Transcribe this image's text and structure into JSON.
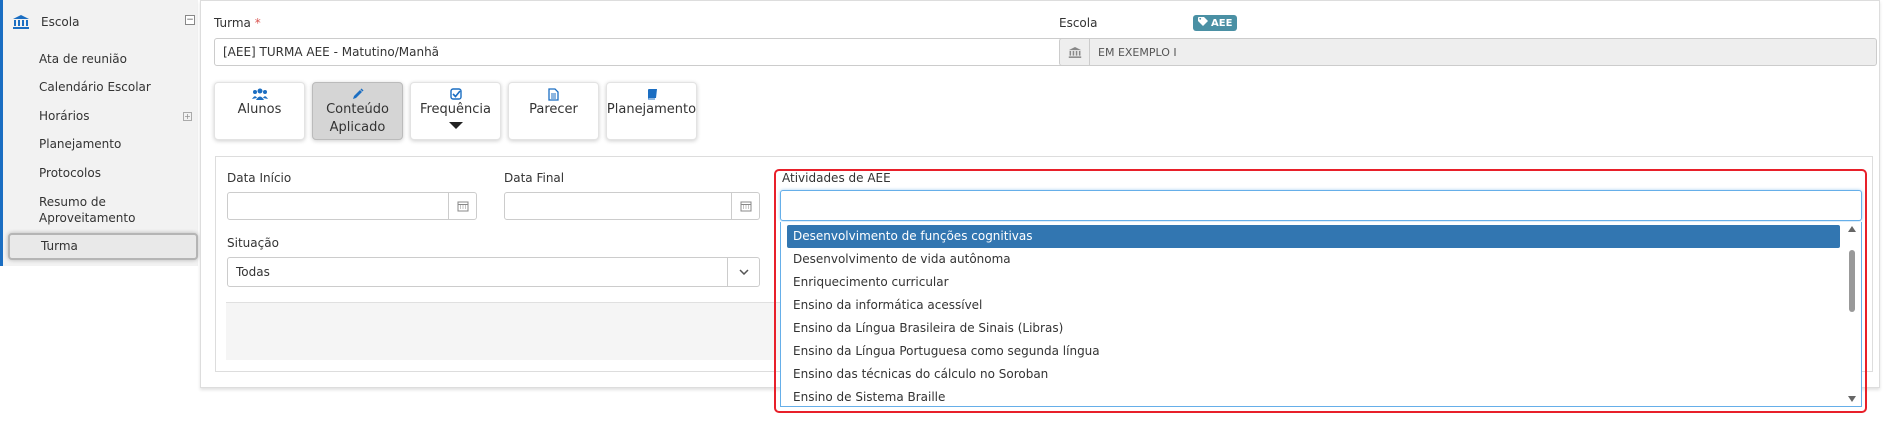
{
  "sidebar": {
    "header_label": "Escola",
    "items": [
      {
        "label": "Ata de reunião"
      },
      {
        "label": "Calendário Escolar"
      },
      {
        "label": "Horários"
      },
      {
        "label": "Planejamento"
      },
      {
        "label": "Protocolos"
      },
      {
        "label": "Resumo de"
      },
      {
        "label": "Aproveitamento"
      },
      {
        "label": "Turma"
      }
    ]
  },
  "form": {
    "turma_label": "Turma",
    "required_mark": "*",
    "aee_badge": "AEE",
    "turma_value": "[AEE]  TURMA AEE - Matutino/Manhã",
    "escola_label": "Escola",
    "escola_value": "EM EXEMPLO I"
  },
  "tabs": [
    {
      "line1": "Alunos",
      "line2": "",
      "icon": "users-icon"
    },
    {
      "line1": "Conteúdo",
      "line2": "Aplicado",
      "icon": "pencil-icon"
    },
    {
      "line1": "Frequência",
      "line2": "",
      "icon": "check-square-icon"
    },
    {
      "line1": "Parecer",
      "line2": "",
      "icon": "document-icon"
    },
    {
      "line1": "Planejamento",
      "line2": "",
      "icon": "book-icon"
    }
  ],
  "filters": {
    "data_inicio_label": "Data Início",
    "data_inicio_value": "",
    "data_final_label": "Data Final",
    "data_final_value": "",
    "situacao_label": "Situação",
    "situacao_value": "Todas",
    "atividades_label": "Atividades de AEE"
  },
  "atividades_options": [
    "Desenvolvimento de funções cognitivas",
    "Desenvolvimento de vida autônoma",
    "Enriquecimento curricular",
    "Ensino da informática acessível",
    "Ensino da Língua Brasileira de Sinais (Libras)",
    "Ensino da Língua Portuguesa como segunda língua",
    "Ensino das técnicas do cálculo no Soroban",
    "Ensino de Sistema Braille"
  ],
  "colors": {
    "accent": "#1b6ec2",
    "selected_option": "#3276b1",
    "highlight": "#e8202a",
    "badge": "#4a90a4"
  }
}
